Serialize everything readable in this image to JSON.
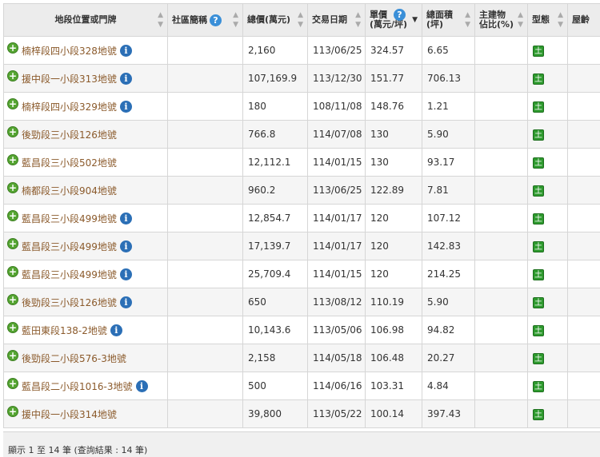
{
  "columns": {
    "location": "地段位置或門牌",
    "community": "社區簡稱",
    "total_price": "總價(萬元)",
    "trade_date": "交易日期",
    "unit_price": "單價\n(萬元/坪)",
    "total_area": "總面積\n(坪)",
    "main_ratio": "主建物\n佔比(%)",
    "type": "型態",
    "age": "屋齡"
  },
  "icons": {
    "expand": "plus-circle-icon",
    "info": "info-icon",
    "help": "question-icon",
    "land_type": "land-type-icon",
    "sort": "sort-arrows-icon"
  },
  "colors": {
    "link": "#8b5a2b",
    "plus": "#55a532",
    "type_badge": "#2e9a2e",
    "info": "#2b6fb6"
  },
  "type_badge_text": "土",
  "rows": [
    {
      "location": "楠梓段四小段328地號",
      "info": true,
      "total": "2,160",
      "date": "113/06/25",
      "unit": "324.57",
      "area": "6.65"
    },
    {
      "location": "援中段一小段313地號",
      "info": true,
      "total": "107,169.9",
      "date": "113/12/30",
      "unit": "151.77",
      "area": "706.13"
    },
    {
      "location": "楠梓段四小段329地號",
      "info": true,
      "total": "180",
      "date": "108/11/08",
      "unit": "148.76",
      "area": "1.21"
    },
    {
      "location": "後勁段三小段126地號",
      "info": false,
      "total": "766.8",
      "date": "114/07/08",
      "unit": "130",
      "area": "5.90"
    },
    {
      "location": "藍昌段三小段502地號",
      "info": false,
      "total": "12,112.1",
      "date": "114/01/15",
      "unit": "130",
      "area": "93.17"
    },
    {
      "location": "楠都段三小段904地號",
      "info": false,
      "total": "960.2",
      "date": "113/06/25",
      "unit": "122.89",
      "area": "7.81"
    },
    {
      "location": "藍昌段三小段499地號",
      "info": true,
      "total": "12,854.7",
      "date": "114/01/17",
      "unit": "120",
      "area": "107.12"
    },
    {
      "location": "藍昌段三小段499地號",
      "info": true,
      "total": "17,139.7",
      "date": "114/01/17",
      "unit": "120",
      "area": "142.83"
    },
    {
      "location": "藍昌段三小段499地號",
      "info": true,
      "total": "25,709.4",
      "date": "114/01/15",
      "unit": "120",
      "area": "214.25"
    },
    {
      "location": "後勁段三小段126地號",
      "info": true,
      "total": "650",
      "date": "113/08/12",
      "unit": "110.19",
      "area": "5.90"
    },
    {
      "location": "藍田東段138-2地號",
      "info": true,
      "total": "10,143.6",
      "date": "113/05/06",
      "unit": "106.98",
      "area": "94.82"
    },
    {
      "location": "後勁段二小段576-3地號",
      "info": false,
      "total": "2,158",
      "date": "114/05/18",
      "unit": "106.48",
      "area": "20.27"
    },
    {
      "location": "藍昌段二小段1016-3地號",
      "info": true,
      "total": "500",
      "date": "114/06/16",
      "unit": "103.31",
      "area": "4.84"
    },
    {
      "location": "援中段一小段314地號",
      "info": false,
      "total": "39,800",
      "date": "113/05/22",
      "unit": "100.14",
      "area": "397.43"
    }
  ],
  "footer_text": "顯示 1 至 14 筆 (查詢結果 : 14 筆)"
}
